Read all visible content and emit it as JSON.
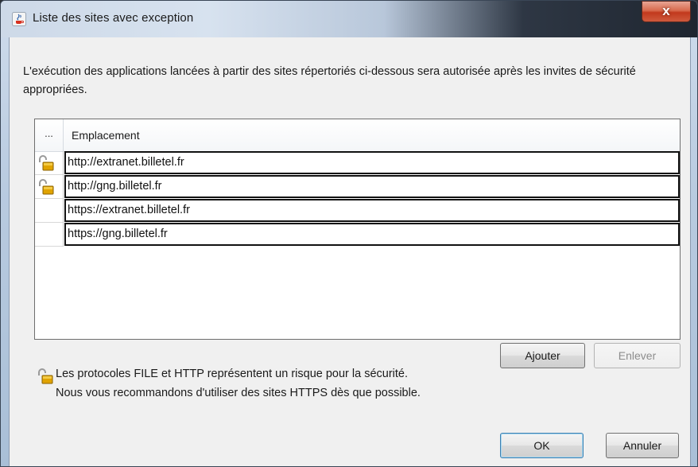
{
  "window": {
    "title": "Liste des sites avec exception",
    "close_label": "x",
    "title_icon": "java-cup-icon"
  },
  "description": "L'exécution des applications lancées à partir des sites répertoriés ci-dessous sera autorisée après les invites de sécurité appropriées.",
  "table": {
    "columns": {
      "icon_header": "...",
      "location_header": "Emplacement"
    },
    "rows": [
      {
        "url": "http://extranet.billetel.fr",
        "icon": "unlocked-padlock-icon"
      },
      {
        "url": "http://gng.billetel.fr",
        "icon": "unlocked-padlock-icon"
      },
      {
        "url": "https://extranet.billetel.fr",
        "icon": ""
      },
      {
        "url": "https://gng.billetel.fr",
        "icon": ""
      }
    ]
  },
  "buttons": {
    "add": "Ajouter",
    "remove": "Enlever",
    "ok": "OK",
    "cancel": "Annuler"
  },
  "warning": {
    "icon": "unlocked-padlock-icon",
    "line1": "Les protocoles FILE et HTTP représentent un risque pour la sécurité.",
    "line2": "Nous vous recommandons d'utiliser des sites HTTPS dès que possible."
  },
  "colors": {
    "padlock": "#e0a300",
    "close_button": "#c2391d"
  }
}
